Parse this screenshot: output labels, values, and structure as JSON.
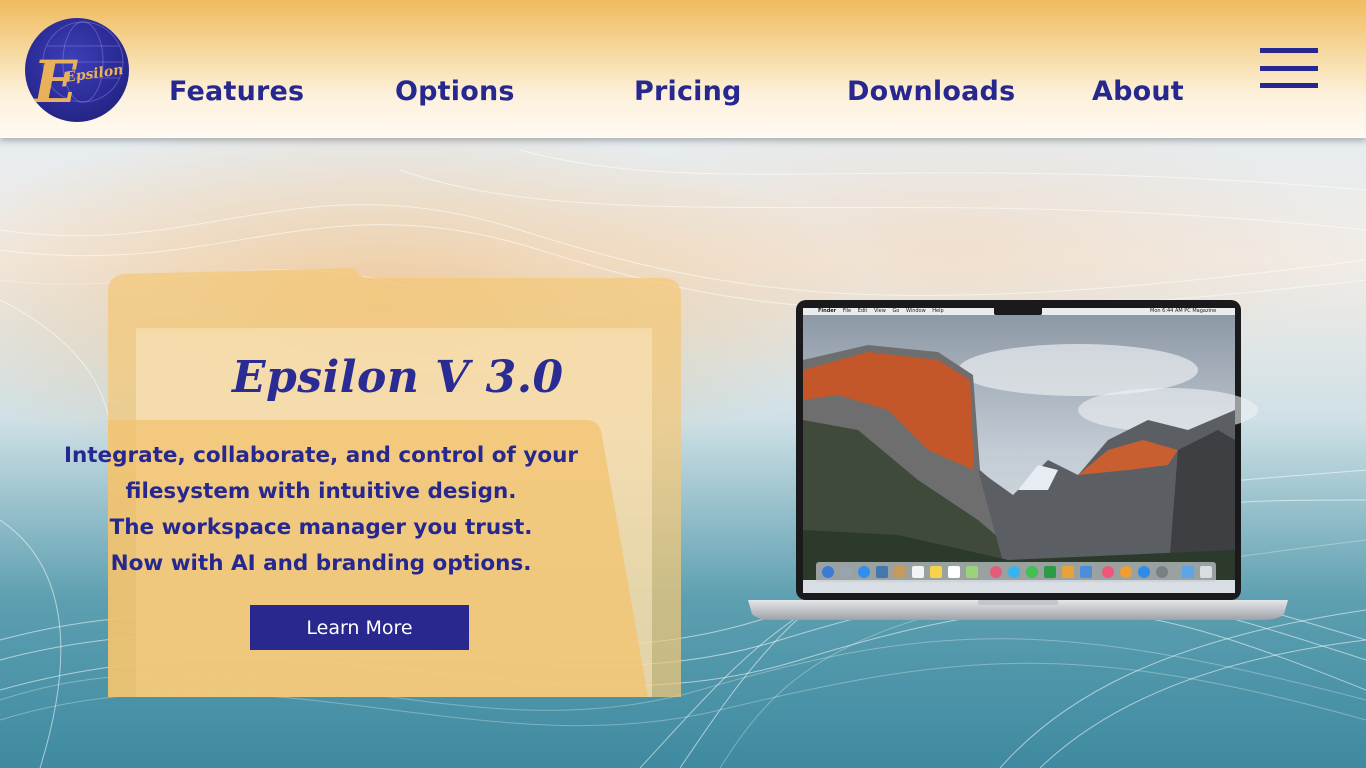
{
  "brand": {
    "logo_text": "Epsilon",
    "colors": {
      "primary": "#27288f",
      "accent": "#f0bb5e",
      "folder": "#f4c877"
    }
  },
  "nav": {
    "links": [
      {
        "label": "Features"
      },
      {
        "label": "Options"
      },
      {
        "label": "Pricing"
      },
      {
        "label": "Downloads"
      },
      {
        "label": "About"
      }
    ],
    "menu_icon": "hamburger-menu-icon"
  },
  "hero": {
    "title": "Epsilon V 3.0",
    "tagline_lines": [
      "Integrate, collaborate, and control of your",
      "filesystem with intuitive design.",
      "The workspace manager you trust.",
      "Now with AI and branding options."
    ],
    "cta_label": "Learn More"
  },
  "laptop_screen": {
    "menubar_left": [
      "Finder",
      "File",
      "Edit",
      "View",
      "Go",
      "Window",
      "Help"
    ],
    "menubar_right": "Mon 6:44 AM   PC Magazine"
  }
}
